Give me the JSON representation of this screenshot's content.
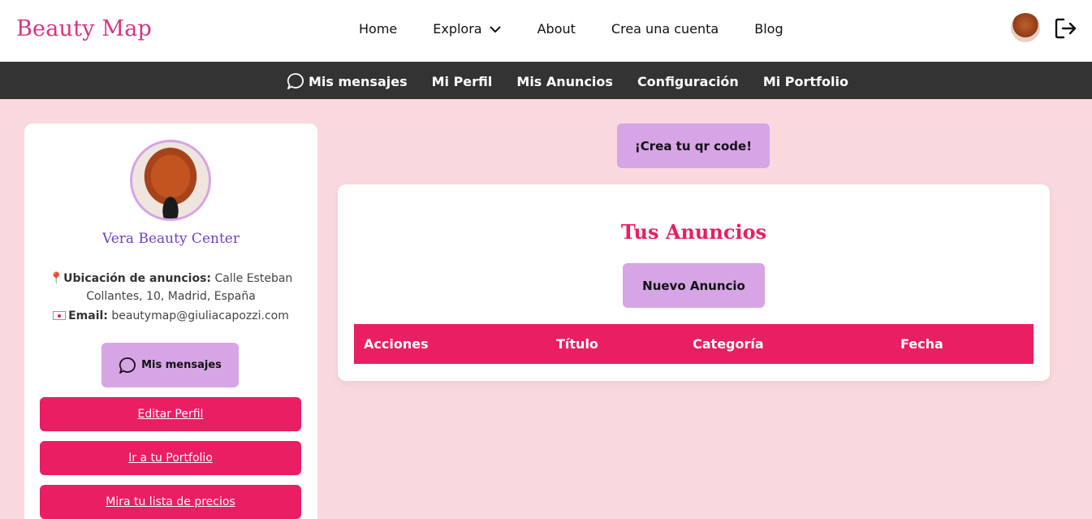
{
  "brand": "Beauty Map",
  "nav": {
    "items": [
      "Home",
      "Explora",
      "About",
      "Crea una cuenta",
      "Blog"
    ]
  },
  "subnav": {
    "items": [
      "Mis mensajes",
      "Mi Perfil",
      "Mis Anuncios",
      "Configuración",
      "Mi Portfolio"
    ]
  },
  "profile": {
    "name": "Vera Beauty Center",
    "location_label": "Ubicación de anuncios:",
    "location_value": "Calle Esteban Collantes, 10, Madrid, España",
    "email_label": "Email:",
    "email_value": "beautymap@giuliacapozzi.com",
    "messages_button": "Mis mensajes",
    "edit_profile": "Editar Perfil",
    "portfolio": "Ir a tu Portfolio",
    "price_list": "Mira tu lista de precios"
  },
  "qr_button": "¡Crea tu qr code!",
  "ads": {
    "title": "Tus Anuncios",
    "new_button": "Nuevo Anuncio",
    "columns": [
      "Acciones",
      "Título",
      "Categoría",
      "Fecha"
    ]
  },
  "colors": {
    "brand": "#d63384",
    "primary": "#e91e63",
    "lavender": "#d7a4e6",
    "background": "#f9d9dd",
    "subnav": "#333333"
  },
  "icons": {
    "chevron": "chevron-down-icon",
    "logout": "logout-icon",
    "chat": "chat-bubble-icon",
    "pin": "location-pin-icon",
    "envelope": "envelope-icon"
  }
}
